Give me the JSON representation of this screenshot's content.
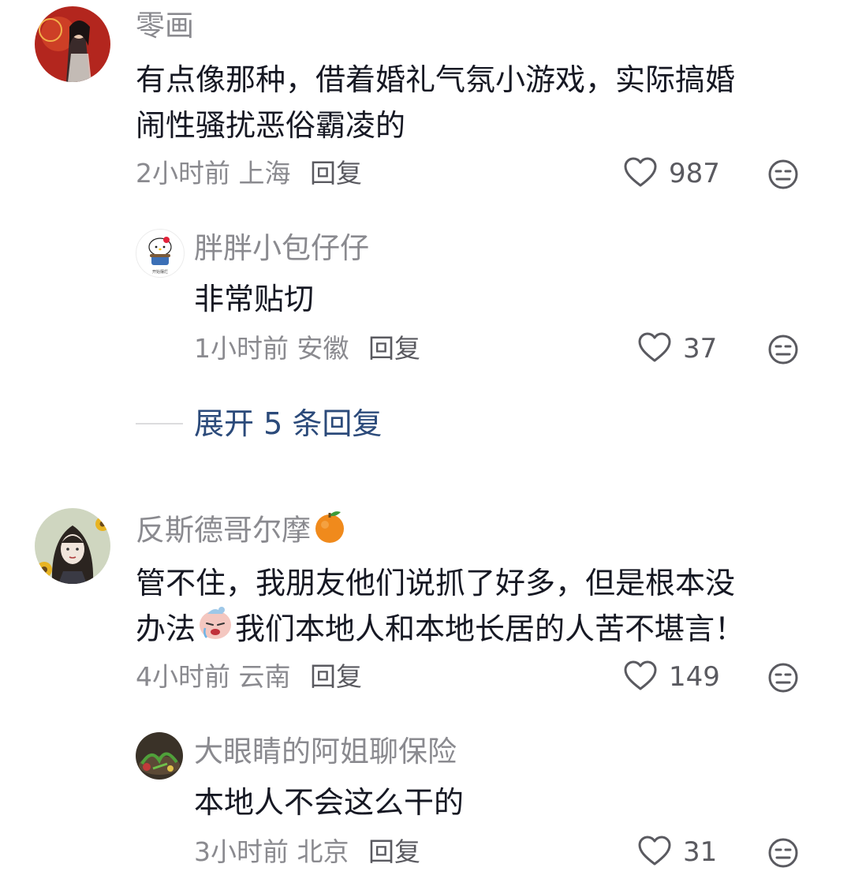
{
  "comments": [
    {
      "username": "零画",
      "content_line1": "有点像那种，借着婚礼气氛小游戏，实际搞婚",
      "content_line2": "闹性骚扰恶俗霸凌的",
      "time": "2小时前",
      "location": "上海",
      "reply_label": "回复",
      "likes": "987",
      "replies": [
        {
          "username": "胖胖小包仔仔",
          "content": "非常贴切",
          "time": "1小时前",
          "location": "安徽",
          "reply_label": "回复",
          "likes": "37",
          "avatar_caption": "开始摆烂"
        }
      ],
      "expand_label": "展开 5 条回复"
    },
    {
      "username": "反斯德哥尔摩",
      "content_line1": "管不住，我朋友他们说抓了好多，但是根本没",
      "content_line2_a": "办法",
      "content_line2_b": "我们本地人和本地长居的人苦不堪言！",
      "time": "4小时前",
      "location": "云南",
      "reply_label": "回复",
      "likes": "149",
      "replies": [
        {
          "username": "大眼睛的阿姐聊保险",
          "content": "本地人不会这么干的",
          "time": "3小时前",
          "location": "北京",
          "reply_label": "回复",
          "likes": "31"
        }
      ]
    }
  ],
  "colors": {
    "username": "#8a8a8f",
    "content": "#161823",
    "expand": "#2b4a7a"
  },
  "icons": [
    "heart-icon",
    "dislike-face-icon",
    "orange-emoji",
    "crying-emoji"
  ]
}
